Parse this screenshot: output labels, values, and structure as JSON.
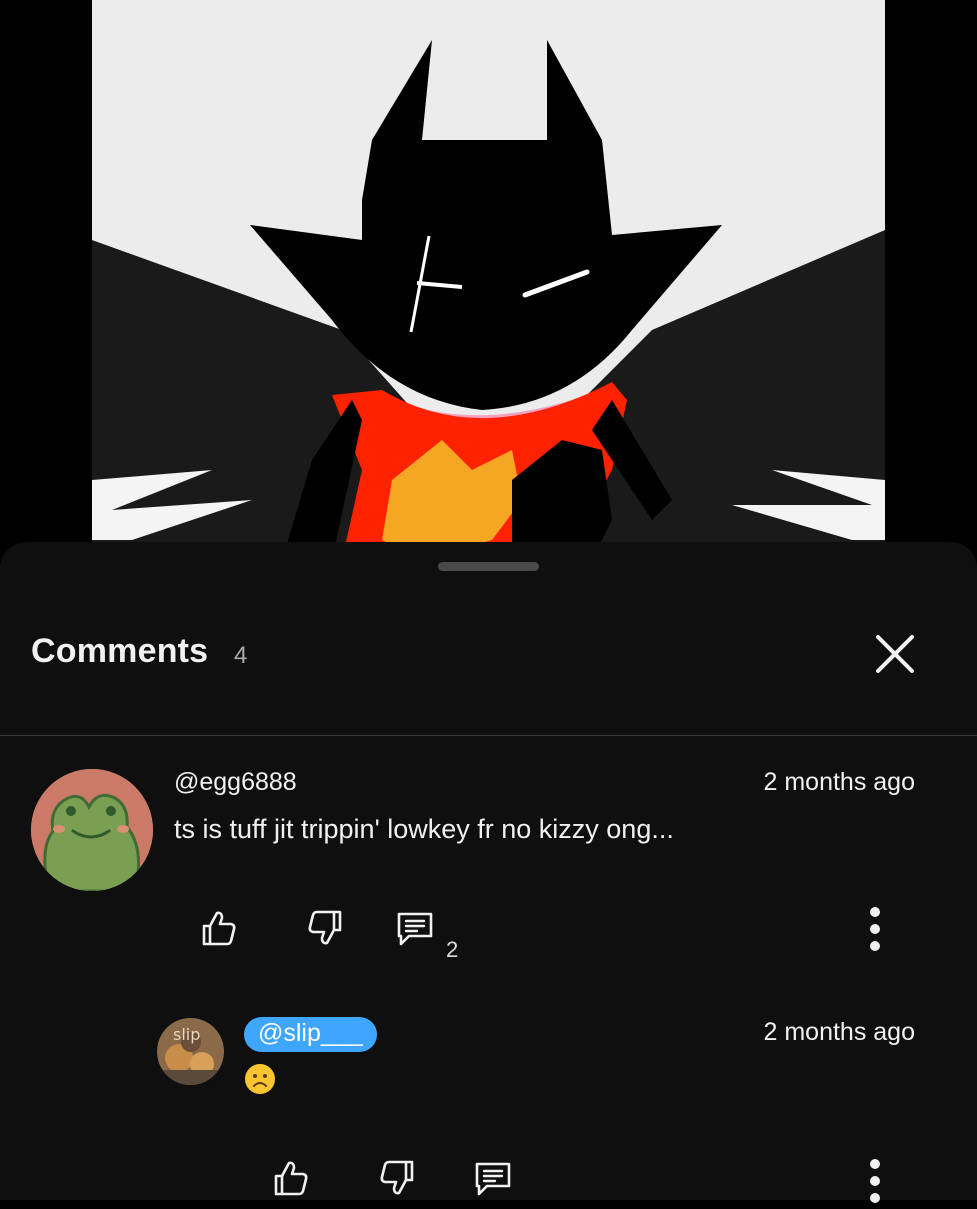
{
  "panel": {
    "title": "Comments",
    "count": "4"
  },
  "comments": [
    {
      "author": "@egg6888",
      "time": "2 months ago",
      "text": "ts is tuff jit trippin' lowkey fr no kizzy ong...",
      "reply_count": "2",
      "avatar_icon": "frog-avatar"
    },
    {
      "author": "@slip___",
      "time": "2 months ago",
      "text": "☹",
      "avatar_icon": "slip-avatar",
      "avatar_label": "slip"
    }
  ],
  "colors": {
    "sheet_bg": "#0f0f0f",
    "accent_chip": "#3ea6ff",
    "text_primary": "#f1f1f1",
    "text_secondary": "#aaaaaa"
  },
  "icons": {
    "like": "thumbs-up-icon",
    "dislike": "thumbs-down-icon",
    "reply": "reply-icon",
    "more": "more-vertical-icon",
    "close": "close-icon"
  }
}
